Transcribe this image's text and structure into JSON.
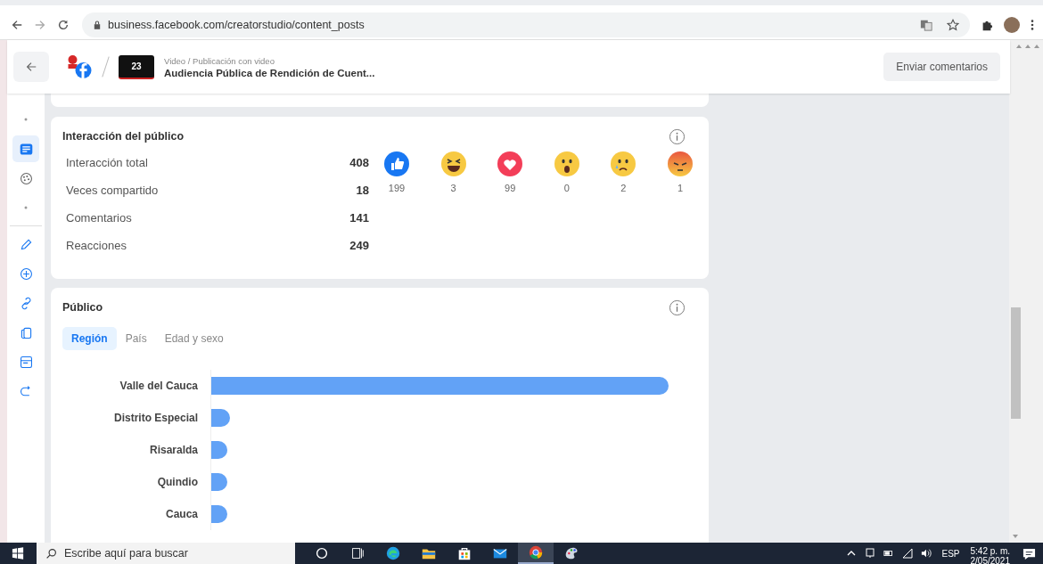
{
  "browser": {
    "url": "business.facebook.com/creatorstudio/content_posts"
  },
  "header": {
    "thumbnail_label": "23",
    "breadcrumb": "Video / Publicación con video",
    "post_title": "Audiencia Pública de Rendición de Cuent...",
    "feedback_button": "Enviar comentarios"
  },
  "sidebar": {
    "sections": [
      {
        "items": [
          {
            "kind": "dot",
            "selected": false
          },
          {
            "kind": "posts",
            "selected": true
          },
          {
            "kind": "palette",
            "selected": false
          },
          {
            "kind": "dot",
            "selected": false
          }
        ]
      },
      {
        "items": [
          {
            "kind": "pencil",
            "selected": false
          },
          {
            "kind": "plus",
            "selected": false
          },
          {
            "kind": "link",
            "selected": false
          },
          {
            "kind": "copy",
            "selected": false
          },
          {
            "kind": "window",
            "selected": false
          },
          {
            "kind": "share",
            "selected": false
          }
        ]
      }
    ]
  },
  "interaction_card": {
    "title": "Interacción del público",
    "stats": [
      {
        "label": "Interacción total",
        "value": "408"
      },
      {
        "label": "Veces compartido",
        "value": "18"
      },
      {
        "label": "Comentarios",
        "value": "141"
      },
      {
        "label": "Reacciones",
        "value": "249"
      }
    ],
    "reactions": [
      {
        "kind": "like",
        "count": "199"
      },
      {
        "kind": "haha",
        "count": "3"
      },
      {
        "kind": "love",
        "count": "99"
      },
      {
        "kind": "wow",
        "count": "0"
      },
      {
        "kind": "sad",
        "count": "2"
      },
      {
        "kind": "angry",
        "count": "1"
      }
    ]
  },
  "audience_card": {
    "title": "Público",
    "tabs": [
      {
        "label": "Región",
        "selected": true
      },
      {
        "label": "País",
        "selected": false
      },
      {
        "label": "Edad y sexo",
        "selected": false
      }
    ],
    "regions": [
      {
        "name": "Valle del Cauca",
        "level": 0.96
      },
      {
        "name": "Distrito Especial",
        "level": 0.04
      },
      {
        "name": "Risaralda",
        "level": 0.033
      },
      {
        "name": "Quindio",
        "level": 0.033
      },
      {
        "name": "Cauca",
        "level": 0.033
      }
    ]
  },
  "taskbar": {
    "search_placeholder": "Escribe aquí para buscar",
    "apps": [
      {
        "kind": "cortana",
        "selected": false
      },
      {
        "kind": "taskview",
        "selected": false
      },
      {
        "kind": "edge",
        "selected": false
      },
      {
        "kind": "explorer",
        "selected": false
      },
      {
        "kind": "store",
        "selected": false
      },
      {
        "kind": "mail",
        "selected": false
      },
      {
        "kind": "chrome",
        "selected": true
      },
      {
        "kind": "paint",
        "selected": false
      }
    ],
    "language": "ESP",
    "time": "5:42 p. m.",
    "date": "2/05/2021"
  }
}
